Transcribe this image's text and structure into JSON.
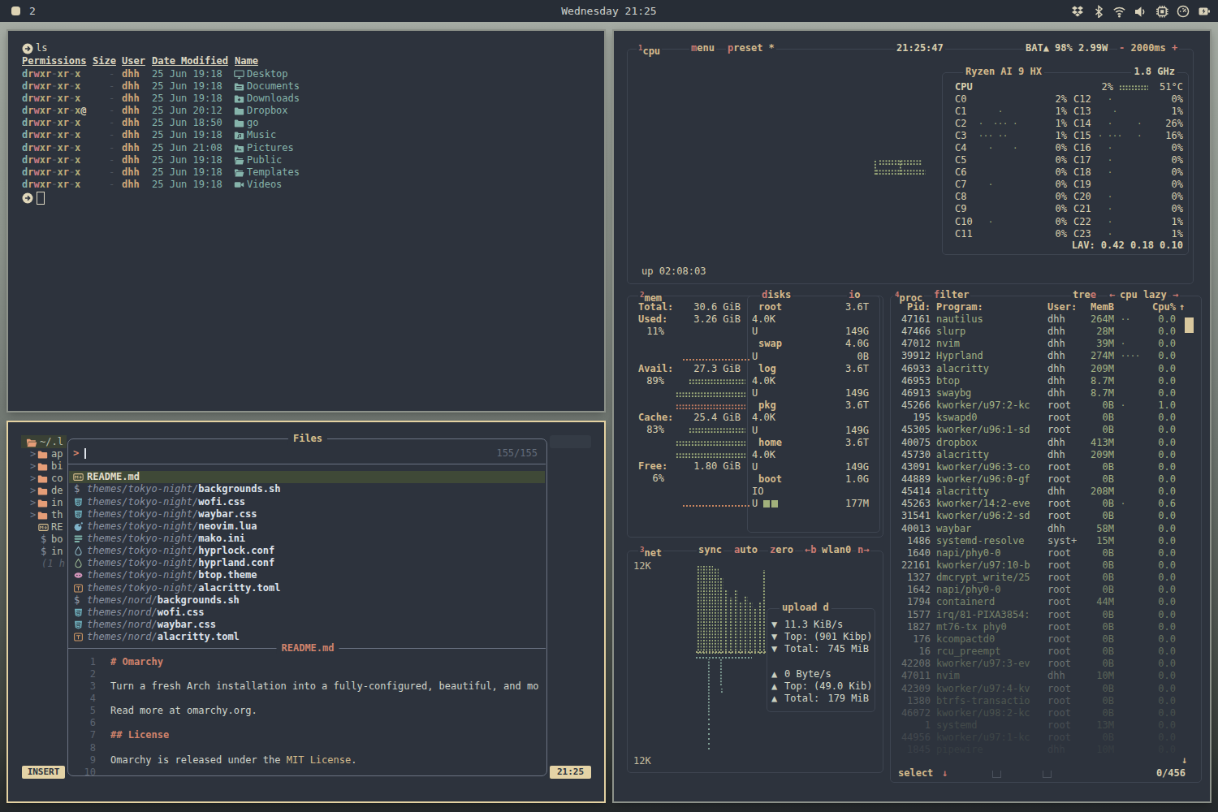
{
  "palette": {
    "bar_bg": "#272d36",
    "window_bg": "#2d333d",
    "wall_top": "#a8aea6",
    "wall_bottom": "#24282b",
    "tan": "#d4ba8c",
    "beige": "#d9cfae",
    "red": "#c97a72",
    "teal": "#86b4ab",
    "rose": "#c77b85",
    "olive": "#b3ad7a",
    "green": "#a2b17c",
    "proc_green": "#a3b284",
    "proc_white": "#c3c8b8",
    "active_border": "#e4d2a2",
    "inactive_border": "#8d928a",
    "salmon": "#e59d77",
    "accent_badge": "#e4d3a6",
    "heading": "#d0836c",
    "upload_teal": "#7f9e94",
    "meter_red": "#c57d62"
  },
  "topbar": {
    "workspace": "2",
    "clock": "Wednesday 21:25",
    "tray": [
      {
        "icon": "dropbox-icon"
      },
      {
        "icon": "bluetooth-icon"
      },
      {
        "icon": "wifi-icon"
      },
      {
        "icon": "volume-icon"
      },
      {
        "icon": "cpu-chip-icon"
      },
      {
        "icon": "gauge-icon"
      },
      {
        "icon": "battery-icon"
      }
    ]
  },
  "terminal": {
    "command": "ls",
    "headers": [
      "Permissions",
      "Size",
      "User",
      "Date Modified",
      "Name"
    ],
    "rows": [
      {
        "perm": "drwxr-xr-x",
        "size": "-",
        "user": "dhh",
        "date": "25 Jun 19:18",
        "icon": "desktop-icon",
        "name": "Desktop"
      },
      {
        "perm": "drwxr-xr-x",
        "size": "-",
        "user": "dhh",
        "date": "25 Jun 19:18",
        "icon": "documents-folder-icon",
        "name": "Documents"
      },
      {
        "perm": "drwxr-xr-x",
        "size": "-",
        "user": "dhh",
        "date": "25 Jun 19:18",
        "icon": "downloads-folder-icon",
        "name": "Downloads"
      },
      {
        "perm": "drwxr-xr-x@",
        "size": "-",
        "user": "dhh",
        "date": "25 Jun 20:12",
        "icon": "folder-icon",
        "name": "Dropbox"
      },
      {
        "perm": "drwxr-xr-x",
        "size": "-",
        "user": "dhh",
        "date": "25 Jun 18:50",
        "icon": "folder-icon",
        "name": "go"
      },
      {
        "perm": "drwxr-xr-x",
        "size": "-",
        "user": "dhh",
        "date": "25 Jun 19:18",
        "icon": "music-folder-icon",
        "name": "Music"
      },
      {
        "perm": "drwxr-xr-x",
        "size": "-",
        "user": "dhh",
        "date": "25 Jun 21:08",
        "icon": "pictures-folder-icon",
        "name": "Pictures"
      },
      {
        "perm": "drwxr-xr-x",
        "size": "-",
        "user": "dhh",
        "date": "25 Jun 19:18",
        "icon": "public-folder-icon",
        "name": "Public"
      },
      {
        "perm": "drwxr-xr-x",
        "size": "-",
        "user": "dhh",
        "date": "25 Jun 19:18",
        "icon": "templates-folder-icon",
        "name": "Templates"
      },
      {
        "perm": "drwxr-xr-x",
        "size": "-",
        "user": "dhh",
        "date": "25 Jun 19:18",
        "icon": "videos-icon",
        "name": "Videos"
      }
    ]
  },
  "neovim": {
    "tree": [
      {
        "label": "~/.l",
        "icon": "folder-open-icon",
        "cursor": true
      },
      {
        "label": "ap",
        "icon": "folder-icon",
        "chevron": ">"
      },
      {
        "label": "bi",
        "icon": "folder-icon",
        "chevron": ">"
      },
      {
        "label": "co",
        "icon": "folder-icon",
        "chevron": ">"
      },
      {
        "label": "de",
        "icon": "folder-icon",
        "chevron": ">"
      },
      {
        "label": "in",
        "icon": "folder-icon",
        "chevron": ">"
      },
      {
        "label": "th",
        "icon": "folder-icon",
        "chevron": ">"
      },
      {
        "label": "RE",
        "icon": "markdown-icon"
      },
      {
        "label": "bo",
        "icon": "shell-icon"
      },
      {
        "label": "in",
        "icon": "shell-icon"
      },
      {
        "label": "(1 h",
        "dim": true
      }
    ],
    "picker": {
      "title": "Files",
      "prompt": ">",
      "count": "155/155",
      "items": [
        {
          "icon": "markdown-icon",
          "dir": "",
          "file": "README.md",
          "selected": true
        },
        {
          "icon": "shell-icon",
          "dir": "themes/tokyo-night/",
          "file": "backgrounds.sh"
        },
        {
          "icon": "css-icon",
          "dir": "themes/tokyo-night/",
          "file": "wofi.css"
        },
        {
          "icon": "css-icon",
          "dir": "themes/tokyo-night/",
          "file": "waybar.css"
        },
        {
          "icon": "lua-icon",
          "dir": "themes/tokyo-night/",
          "file": "neovim.lua"
        },
        {
          "icon": "ini-icon",
          "dir": "themes/tokyo-night/",
          "file": "mako.ini"
        },
        {
          "icon": "droplet-icon",
          "dir": "themes/tokyo-night/",
          "file": "hyprlock.conf"
        },
        {
          "icon": "droplet2-icon",
          "dir": "themes/tokyo-night/",
          "file": "hyprland.conf"
        },
        {
          "icon": "theme-icon",
          "dir": "themes/tokyo-night/",
          "file": "btop.theme"
        },
        {
          "icon": "toml-icon",
          "dir": "themes/tokyo-night/",
          "file": "alacritty.toml"
        },
        {
          "icon": "shell-icon",
          "dir": "themes/nord/",
          "file": "backgrounds.sh"
        },
        {
          "icon": "css-icon",
          "dir": "themes/nord/",
          "file": "wofi.css"
        },
        {
          "icon": "css-icon",
          "dir": "themes/nord/",
          "file": "waybar.css"
        },
        {
          "icon": "toml-icon",
          "dir": "themes/nord/",
          "file": "alacritty.toml"
        }
      ],
      "preview_title": "README.md",
      "preview": [
        {
          "n": "1",
          "segments": [
            {
              "text": "# Omarchy",
              "color": "heading"
            }
          ]
        },
        {
          "n": "2",
          "segments": []
        },
        {
          "n": "3",
          "segments": [
            {
              "text": "Turn a fresh Arch installation into a fully-configured, beautiful, and mo"
            }
          ]
        },
        {
          "n": "4",
          "segments": []
        },
        {
          "n": "5",
          "segments": [
            {
              "text": "Read more at omarchy.org."
            }
          ]
        },
        {
          "n": "6",
          "segments": []
        },
        {
          "n": "7",
          "segments": [
            {
              "text": "## License",
              "color": "heading"
            }
          ]
        },
        {
          "n": "8",
          "segments": []
        },
        {
          "n": "9",
          "segments": [
            {
              "text": "Omarchy is released under the "
            },
            {
              "text": "MIT License",
              "color": "tan"
            },
            {
              "text": "."
            }
          ]
        },
        {
          "n": "10",
          "segments": []
        }
      ]
    },
    "mode_badge": "INSERT",
    "clock_badge": "21:25"
  },
  "btop": {
    "cpu": {
      "tab_key": "1",
      "tab": "cpu",
      "menu_key": "m",
      "menu": "enu",
      "preset_key": "p",
      "preset": "reset *",
      "time": "21:25:47",
      "battery": "BAT▲ 98% 2.99W",
      "minus": "-",
      "interval": "2000ms",
      "plus": "+",
      "model": "Ryzen AI 9 HX",
      "freq": "1.8 GHz",
      "summary_label": "CPU",
      "summary_pct": "2%",
      "summary_temp": "51°C",
      "cores_left": [
        [
          "C0",
          "2%"
        ],
        [
          "C1",
          "1%"
        ],
        [
          "C2",
          "1%"
        ],
        [
          "C3",
          "1%"
        ],
        [
          "C4",
          "0%"
        ],
        [
          "C5",
          "0%"
        ],
        [
          "C6",
          "0%"
        ],
        [
          "C7",
          "0%"
        ],
        [
          "C8",
          "0%"
        ],
        [
          "C9",
          "0%"
        ],
        [
          "C10",
          "0%"
        ],
        [
          "C11",
          "0%"
        ]
      ],
      "dots_left": [
        "",
        "    ·",
        "·  ··· ·",
        "··· ··",
        "  ·    ·",
        "",
        "",
        "  ·",
        "",
        "",
        "  ·",
        ""
      ],
      "cores_right": [
        [
          "C12",
          "0%"
        ],
        [
          "C13",
          "1%"
        ],
        [
          "C14",
          "26%"
        ],
        [
          "C15",
          "16%"
        ],
        [
          "C16",
          "0%"
        ],
        [
          "C17",
          "0%"
        ],
        [
          "C18",
          "0%"
        ],
        [
          "C19",
          "0%"
        ],
        [
          "C20",
          "0%"
        ],
        [
          "C21",
          "0%"
        ],
        [
          "C22",
          "1%"
        ],
        [
          "C23",
          "1%"
        ]
      ],
      "dots_right": [
        "  ·",
        "   ·",
        "  ·     ·",
        "· ···   ·",
        "  ·",
        "  ·",
        "  ·",
        "",
        "  ·",
        "  ·",
        "  ·",
        "  ·"
      ],
      "lav": "LAV: 0.42 0.18 0.10",
      "uptime": "up 02:08:03"
    },
    "mem": {
      "tab_key": "2",
      "tab": "mem",
      "stats": [
        {
          "label": "Total:",
          "value": "30.6 GiB"
        },
        {
          "label": "Used:",
          "value": "3.26 GiB"
        },
        {
          "pct": "11%"
        },
        {
          "label": "Avail:",
          "value": "27.3 GiB"
        },
        {
          "pct": "89%"
        },
        {
          "label": "Cache:",
          "value": "25.4 GiB"
        },
        {
          "pct": "83%"
        },
        {
          "label": "Free:",
          "value": "1.80 GiB"
        },
        {
          "pct": "6%"
        }
      ]
    },
    "disks": {
      "title_key": "d",
      "title": "isks",
      "io_key": "i",
      "io": "o",
      "rows": [
        {
          "name": "root",
          "value": "3.6T"
        },
        {
          "text": "4.0K"
        },
        {
          "text": "U",
          "value": "149G"
        },
        {
          "name": "swap",
          "value": "4.0G"
        },
        {
          "text": "U",
          "value": "0B"
        },
        {
          "name": "log",
          "value": "3.6T"
        },
        {
          "text": "4.0K"
        },
        {
          "text": "U",
          "value": "149G"
        },
        {
          "name": "pkg",
          "value": "3.6T"
        },
        {
          "text": "4.0K"
        },
        {
          "text": "U",
          "value": "149G"
        },
        {
          "name": "home",
          "value": "3.6T"
        },
        {
          "text": "4.0K"
        },
        {
          "text": "U",
          "value": "149G"
        },
        {
          "name": "boot",
          "value": "1.0G"
        },
        {
          "text": "IO"
        },
        {
          "text": "U",
          "value": "177M",
          "blocks": true
        }
      ]
    },
    "net": {
      "tab_key": "3",
      "tab": "net",
      "sync": "sync",
      "auto_key": "a",
      "auto": "uto",
      "zero_key": "z",
      "zero": "ero",
      "prev": "←b",
      "iface": "wlan0",
      "next": "n→",
      "scale_top": "12K",
      "scale_bottom": "12K",
      "stats_title": "upload d",
      "stats": [
        {
          "arrow": "▼",
          "text": "11.3 KiB/s"
        },
        {
          "arrow": "▼",
          "text": "Top: (901 Kibp)"
        },
        {
          "arrow": "▼",
          "text": "Total:",
          "value": "745 MiB"
        },
        {},
        {
          "arrow": "▲",
          "text": "0 Byte/s"
        },
        {
          "arrow": "▲",
          "text": "Top: (49.0 Kib)"
        },
        {
          "arrow": "▲",
          "text": "Total:",
          "value": "179 MiB"
        }
      ]
    },
    "proc": {
      "tab_key": "4",
      "tab": "proc",
      "filter_key": "f",
      "filter": "ilter",
      "tree": "tre",
      "tree_key": "e",
      "prev": "←",
      "cpu_lazy": "cpu lazy",
      "next": "→",
      "headers": {
        "pid": "Pid:",
        "program": "Program:",
        "user": "User:",
        "mem": "MemB",
        "cpu": "Cpu%",
        "sort": "↑"
      },
      "rows": [
        [
          "47161",
          "nautilus",
          "dhh",
          "264M",
          "··",
          "0.0"
        ],
        [
          "47466",
          "slurp",
          "dhh",
          "28M",
          "",
          "0.0"
        ],
        [
          "47012",
          "nvim",
          "dhh",
          "39M",
          "·",
          "0.0"
        ],
        [
          "39912",
          "Hyprland",
          "dhh",
          "274M",
          "····",
          "0.0"
        ],
        [
          "46933",
          "alacritty",
          "dhh",
          "209M",
          "",
          "0.0"
        ],
        [
          "46953",
          "btop",
          "dhh",
          "8.7M",
          "",
          "0.0"
        ],
        [
          "46913",
          "swaybg",
          "dhh",
          "8.7M",
          "",
          "0.0"
        ],
        [
          "45266",
          "kworker/u97:2-kc",
          "root",
          "0B",
          "·",
          "1.0"
        ],
        [
          "195",
          "kswapd0",
          "root",
          "0B",
          "",
          "0.0"
        ],
        [
          "45305",
          "kworker/u96:1-sd",
          "root",
          "0B",
          "",
          "0.0"
        ],
        [
          "40075",
          "dropbox",
          "dhh",
          "413M",
          "",
          "0.0"
        ],
        [
          "45730",
          "alacritty",
          "dhh",
          "209M",
          "",
          "0.0"
        ],
        [
          "43091",
          "kworker/u96:3-co",
          "root",
          "0B",
          "",
          "0.0"
        ],
        [
          "44889",
          "kworker/u96:0-gf",
          "root",
          "0B",
          "",
          "0.0"
        ],
        [
          "45414",
          "alacritty",
          "dhh",
          "208M",
          "",
          "0.0"
        ],
        [
          "45263",
          "kworker/14:2-eve",
          "root",
          "0B",
          "·",
          "0.6"
        ],
        [
          "31541",
          "kworker/u96:2-sd",
          "root",
          "0B",
          "",
          "0.0"
        ],
        [
          "40013",
          "waybar",
          "dhh",
          "58M",
          "",
          "0.0"
        ],
        [
          "1486",
          "systemd-resolve",
          "syst+",
          "15M",
          "",
          "0.0"
        ],
        [
          "1640",
          "napi/phy0-0",
          "root",
          "0B",
          "",
          "0.0"
        ],
        [
          "22161",
          "kworker/u97:10-b",
          "root",
          "0B",
          "",
          "0.0"
        ],
        [
          "1327",
          "dmcrypt_write/25",
          "root",
          "0B",
          "",
          "0.0"
        ],
        [
          "1642",
          "napi/phy0-0",
          "root",
          "0B",
          "",
          "0.0"
        ],
        [
          "1794",
          "containerd",
          "root",
          "44M",
          "",
          "0.0"
        ],
        [
          "1577",
          "irq/81-PIXA3854:",
          "root",
          "0B",
          "",
          "0.0"
        ],
        [
          "1827",
          "mt76-tx phy0",
          "root",
          "0B",
          "",
          "0.0"
        ],
        [
          "176",
          "kcompactd0",
          "root",
          "0B",
          "",
          "0.0"
        ],
        [
          "16",
          "rcu_preempt",
          "root",
          "0B",
          "",
          "0.0"
        ],
        [
          "42208",
          "kworker/u97:3-ev",
          "root",
          "0B",
          "",
          "0.0"
        ],
        [
          "47011",
          "nvim",
          "dhh",
          "10M",
          "",
          "0.0"
        ],
        [
          "42309",
          "kworker/u97:4-kv",
          "root",
          "0B",
          "",
          "0.0"
        ],
        [
          "1380",
          "btrfs-transactio",
          "root",
          "0B",
          "",
          "0.0"
        ],
        [
          "46072",
          "kworker/u98:2-kc",
          "root",
          "0B",
          "",
          "0.0"
        ],
        [
          "1",
          "systemd",
          "root",
          "13M",
          "",
          "0.0"
        ],
        [
          "44956",
          "kworker/u97:1-kc",
          "root",
          "0B",
          "",
          "0.0"
        ],
        [
          "1845",
          "pipewire",
          "dhh",
          "10M",
          "",
          "0.0"
        ]
      ],
      "footer": {
        "select": "select",
        "select_arrow": "↓",
        "count": "0/456",
        "scroll_arrow": "↓"
      }
    }
  }
}
